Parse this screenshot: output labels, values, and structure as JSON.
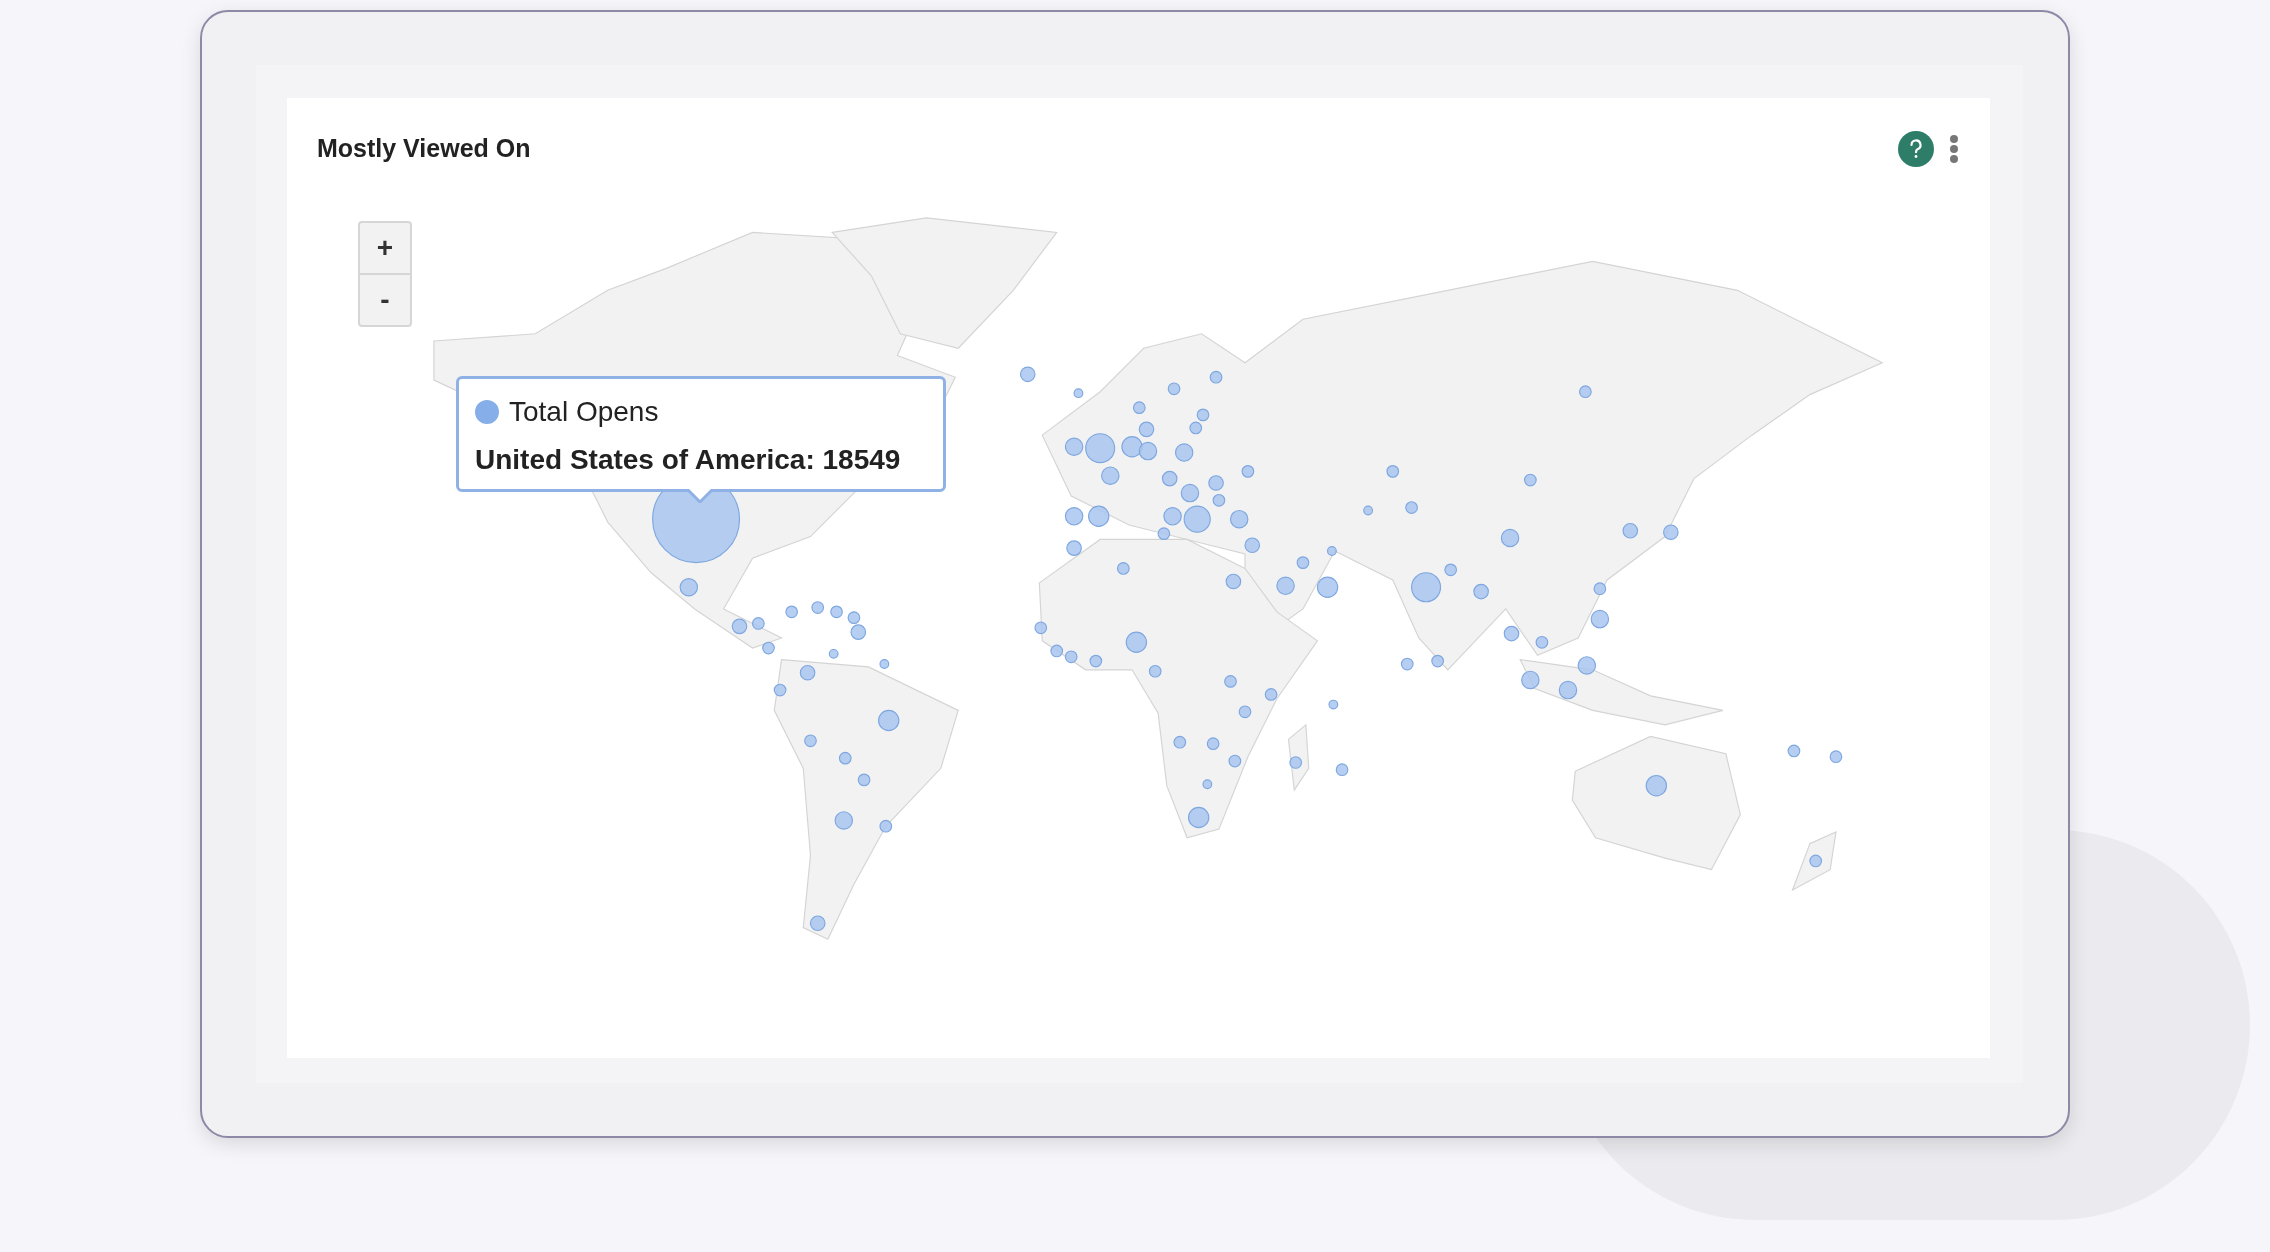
{
  "card": {
    "title": "Mostly Viewed On"
  },
  "map": {
    "zoom_buttons": [
      "+",
      "-"
    ],
    "tooltip": {
      "series": "Total Opens",
      "label": "United States of America: 18549"
    }
  }
}
